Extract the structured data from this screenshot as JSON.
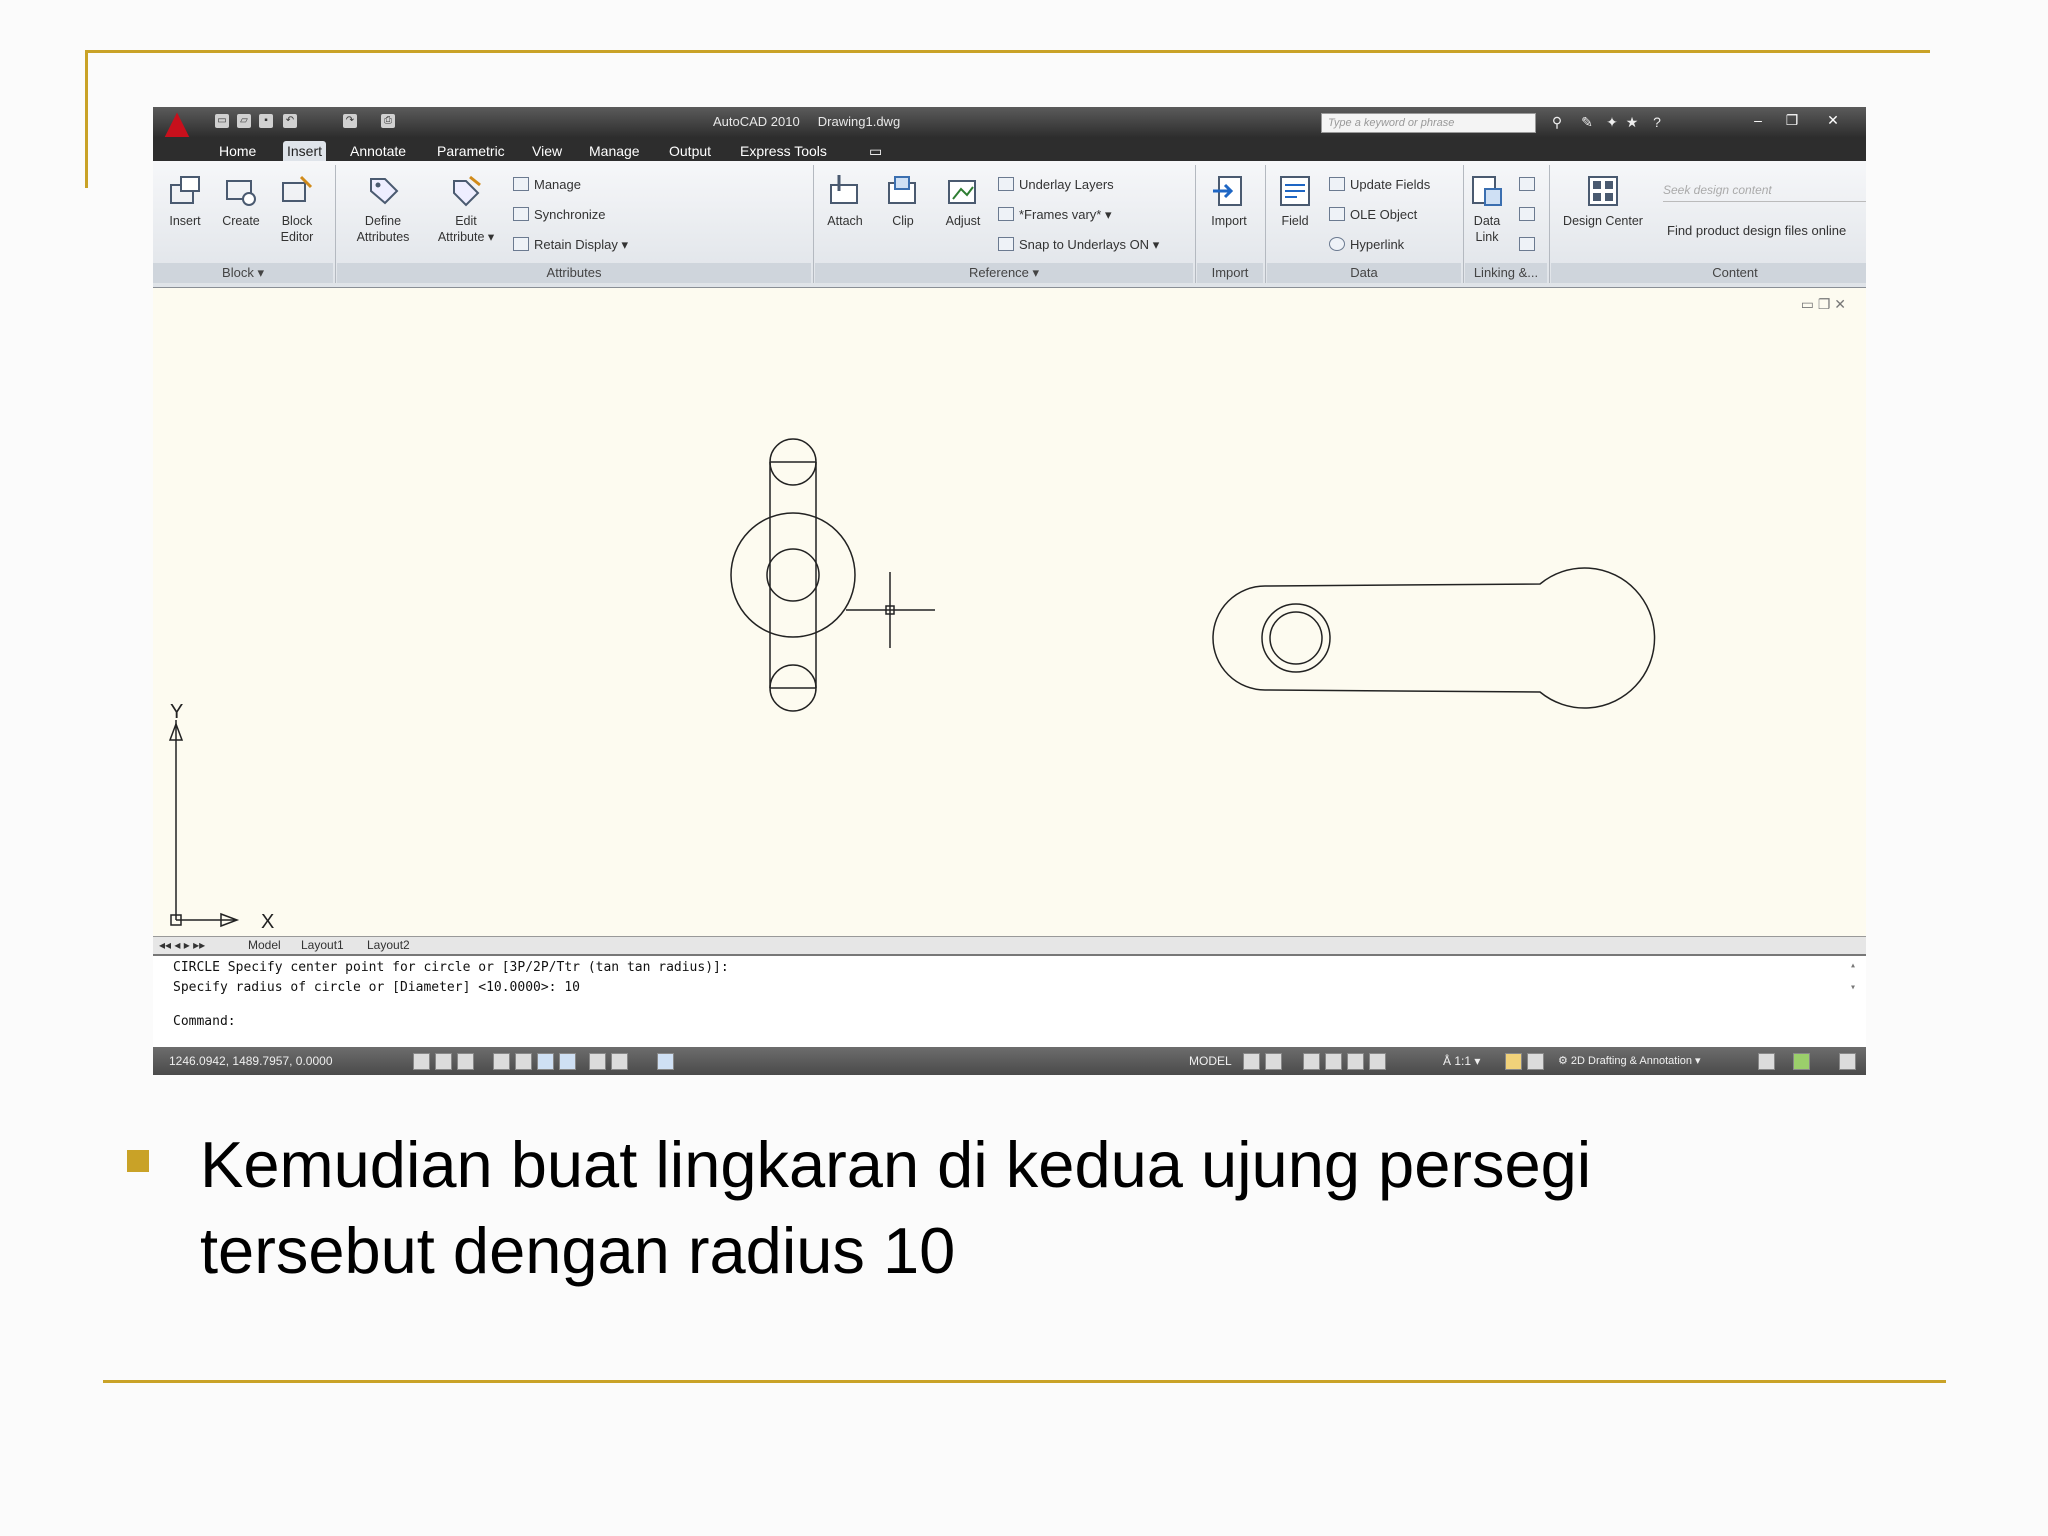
{
  "slide": {
    "caption_line1": "Kemudian buat lingkaran di kedua ujung persegi",
    "caption_line2": "tersebut dengan radius 10",
    "accent_color": "#c9a227"
  },
  "app": {
    "title": "AutoCAD 2010",
    "document": "Drawing1.dwg",
    "search_placeholder": "Type a keyword or phrase"
  },
  "tabs": [
    "Home",
    "Insert",
    "Annotate",
    "Parametric",
    "View",
    "Manage",
    "Output",
    "Express Tools"
  ],
  "active_tab": "Insert",
  "ribbon": {
    "block": {
      "title": "Block",
      "insert": "Insert",
      "create": "Create",
      "block_editor_1": "Block",
      "block_editor_2": "Editor"
    },
    "attributes": {
      "title": "Attributes",
      "define_1": "Define",
      "define_2": "Attributes",
      "edit_1": "Edit",
      "edit_2": "Attribute",
      "manage": "Manage",
      "synchronize": "Synchronize",
      "retain": "Retain Display"
    },
    "reference": {
      "title": "Reference",
      "attach": "Attach",
      "clip": "Clip",
      "adjust": "Adjust",
      "underlay": "Underlay Layers",
      "frames": "*Frames vary*",
      "snap": "Snap to Underlays ON"
    },
    "import": {
      "title": "Import",
      "import": "Import"
    },
    "data": {
      "title": "Data",
      "field": "Field",
      "update": "Update Fields",
      "ole": "OLE Object",
      "hyperlink": "Hyperlink"
    },
    "linking": {
      "title": "Linking &...",
      "data_link_1": "Data",
      "data_link_2": "Link"
    },
    "content": {
      "title": "Content",
      "design_center": "Design Center",
      "seek_placeholder": "Seek design content",
      "find": "Find product design files online"
    }
  },
  "canvas": {
    "axis_y": "Y",
    "axis_x": "X"
  },
  "layout_tabs": [
    "Model",
    "Layout1",
    "Layout2"
  ],
  "command": {
    "line1": "CIRCLE Specify center point for circle or [3P/2P/Ttr (tan tan radius)]:",
    "line2": "Specify radius of circle or [Diameter] <10.0000>: 10",
    "prompt": "Command:"
  },
  "status": {
    "coords": "1246.0942, 1489.7957, 0.0000",
    "model": "MODEL",
    "scale": "1:1",
    "workspace": "2D Drafting & Annotation"
  }
}
